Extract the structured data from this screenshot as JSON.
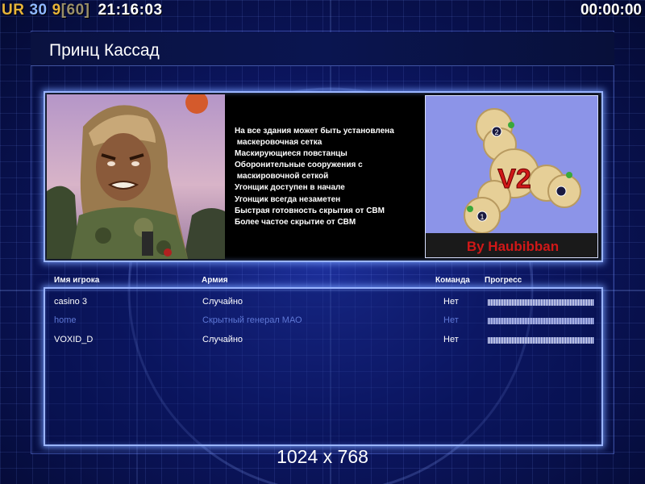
{
  "hud": {
    "rank": "UR",
    "a": "30",
    "b": "9",
    "c": "[60]",
    "clock": "21:16:03",
    "timer": "00:00:00"
  },
  "map": {
    "title": "Принц Кассад",
    "features": [
      "На все здания может быть установлена",
      " маскеровочная сетка",
      "Маскирующиеся повстанцы",
      "Оборонительные сооружения с",
      " маскировочной сеткой",
      "Угонщик доступен в начале",
      "Угонщик всегда незаметен",
      "Быстрая готовность скрытия от СВМ",
      "Более частое скрытие от СВМ"
    ],
    "minimap_label": "V2",
    "minimap_credit": "By Haubibban",
    "start_1": "1",
    "start_2": "2"
  },
  "table": {
    "headers": {
      "player": "Имя игрока",
      "army": "Армия",
      "team": "Команда",
      "progress": "Прогресс"
    },
    "rows": [
      {
        "name": "casino 3",
        "army": "Случайно",
        "team": "Нет",
        "progress": 100,
        "dim": false
      },
      {
        "name": "home",
        "army": "Скрытный генерал МАО",
        "team": "Нет",
        "progress": 100,
        "dim": true
      },
      {
        "name": "VOXID_D",
        "army": "Случайно",
        "team": "Нет",
        "progress": 100,
        "dim": false
      }
    ]
  },
  "resolution": "1024 x 768",
  "colors": {
    "accent": "#9ab4ff",
    "rank": "#e7b43a",
    "dim_text": "#5f78d6"
  }
}
